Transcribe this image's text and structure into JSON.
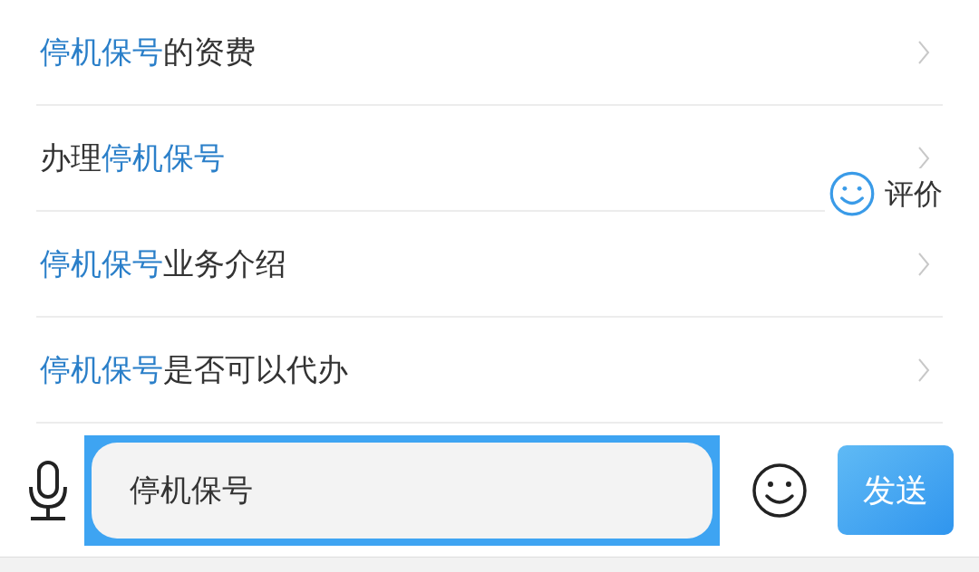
{
  "suggestions": [
    {
      "segments": [
        {
          "text": "停机保号",
          "highlight": true
        },
        {
          "text": "的资费",
          "highlight": false
        }
      ]
    },
    {
      "segments": [
        {
          "text": "办理",
          "highlight": false
        },
        {
          "text": "停机保号",
          "highlight": true
        }
      ]
    },
    {
      "segments": [
        {
          "text": "停机保号",
          "highlight": true
        },
        {
          "text": "业务介绍",
          "highlight": false
        }
      ]
    },
    {
      "segments": [
        {
          "text": "停机保号",
          "highlight": true
        },
        {
          "text": "是否可以代办",
          "highlight": false
        }
      ]
    }
  ],
  "rate_button": {
    "label": "评价"
  },
  "composer": {
    "value": "停机保号",
    "highlighted": true,
    "send_label": "发送"
  }
}
